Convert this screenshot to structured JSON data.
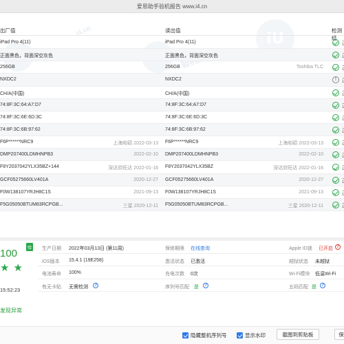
{
  "window": {
    "title": "爱思助手验机报告 www.i4.cn"
  },
  "watermark": {
    "text_1": "i4.cn",
    "text_2": "验机报告",
    "logo": "iU"
  },
  "table": {
    "headers": {
      "factory": "出厂值",
      "read": "读出值",
      "result": "检测结"
    },
    "rows": [
      {
        "factory": "iPad Pro 4(11)",
        "factory_meta": "",
        "read": "iPad Pro 4(11)",
        "read_meta": "",
        "status": "check",
        "status_label": "正"
      },
      {
        "factory": "正面黑色，背面深空灰色",
        "factory_meta": "",
        "read": "正面黑色，背面深空灰色",
        "read_meta": "",
        "status": "check",
        "status_label": "正"
      },
      {
        "factory": "256GB",
        "factory_meta": "",
        "read": "256GB",
        "read_meta": "Toshiba TLC",
        "status": "check",
        "status_label": "正"
      },
      {
        "factory": "NXDC2",
        "factory_meta": "",
        "read": "NXDC2",
        "read_meta": "",
        "status": "info",
        "status_label": "正"
      },
      {
        "factory": "CH/A(中国)",
        "factory_meta": "",
        "read": "CH/A(中国)",
        "read_meta": "",
        "status": "check",
        "status_label": "正"
      },
      {
        "factory": "74:8F:3C:64:A7:D7",
        "factory_meta": "",
        "read": "74:8F:3C:64:A7:D7",
        "read_meta": "",
        "status": "check",
        "status_label": "正"
      },
      {
        "factory": "74:8F:3C:6E:6D:3C",
        "factory_meta": "",
        "read": "74:8F:3C:6E:6D:3C",
        "read_meta": "",
        "status": "check",
        "status_label": "正"
      },
      {
        "factory": "74:8F:3C:6B:97:62",
        "factory_meta": "",
        "read": "74:8F:3C:6B:97:62",
        "read_meta": "",
        "status": "check",
        "status_label": "正"
      },
      {
        "factory": "F6P******NRC9",
        "factory_meta": "上海和硕  2022-03-13",
        "read": "F6P******NRC9",
        "read_meta": "上海和硕  2022-03-13",
        "status": "check",
        "status_label": "正"
      },
      {
        "factory": "DMP207400LDMHNPB3",
        "factory_meta": "2022-02-10",
        "read": "DMP207400LDMHNPB3",
        "read_meta": "2022-02-10",
        "status": "check",
        "status_label": "正"
      },
      {
        "factory": "F8Y2037042YLX35BZ+144",
        "factory_meta": "深达欣旺达  2022-01-16",
        "read": "F8Y2037042YLX35BZ",
        "read_meta": "深达欣旺达  2022-01-16",
        "status": "check",
        "status_label": "正"
      },
      {
        "factory": "GCF05275660LV401A",
        "factory_meta": "2020-12-27",
        "read": "GCF05275660LV401A",
        "read_meta": "2020-12-27",
        "status": "check",
        "status_label": "正"
      },
      {
        "factory": "F0W138107YRJH8C1S",
        "factory_meta": "2021-09-13",
        "read": "F0W138107YRJH8C1S",
        "read_meta": "2021-09-13",
        "status": "check",
        "status_label": "正"
      },
      {
        "factory": "F5G05050BTUM83RCPGB...",
        "factory_meta": "三星  2020-12-11",
        "read": "F5G05050BTUM83RCPGB...",
        "read_meta": "三星  2020-12-11",
        "status": "check",
        "status_label": "正"
      }
    ]
  },
  "summary": {
    "score": "100",
    "verified_badge": "验",
    "stars": [
      "★",
      "★"
    ],
    "time": "15:52:23",
    "detected": "发现异常"
  },
  "info": {
    "production_date_label": "生产日期",
    "production_date": "2022年03月13日 (第11周)",
    "warranty_label": "保修期限",
    "warranty_value": "在线查询",
    "apple_id_label": "Apple ID锁",
    "apple_id_value": "已开启",
    "ios_label": "iOS版本",
    "ios_value": "15.4.1 (19E258)",
    "activation_label": "激活状态",
    "activation_value": "已激活",
    "jailbreak_label": "越狱状态",
    "jailbreak_value": "未越狱",
    "battery_label": "电池寿命",
    "battery_value": "100%",
    "charge_label": "充电次数",
    "charge_value": "0次",
    "wifi_label": "Wi-Fi模块",
    "wifi_value": "低温Wi-Fi",
    "sim_label": "有无卡贴",
    "sim_value": "无需检测",
    "serial_match_label": "序列号匹配",
    "serial_match_value": "是",
    "five_code_label": "五码匹配",
    "five_code_value": "是",
    "help_glyph": "?"
  },
  "footer": {
    "hide_serial": "隐藏整机序列号",
    "show_watermark": "显示水印",
    "copy_button": "截图到剪贴板",
    "save_button": "保"
  },
  "colors": {
    "accent": "#2f7be8",
    "ok": "#2aa84a",
    "alert": "#e03c31"
  }
}
